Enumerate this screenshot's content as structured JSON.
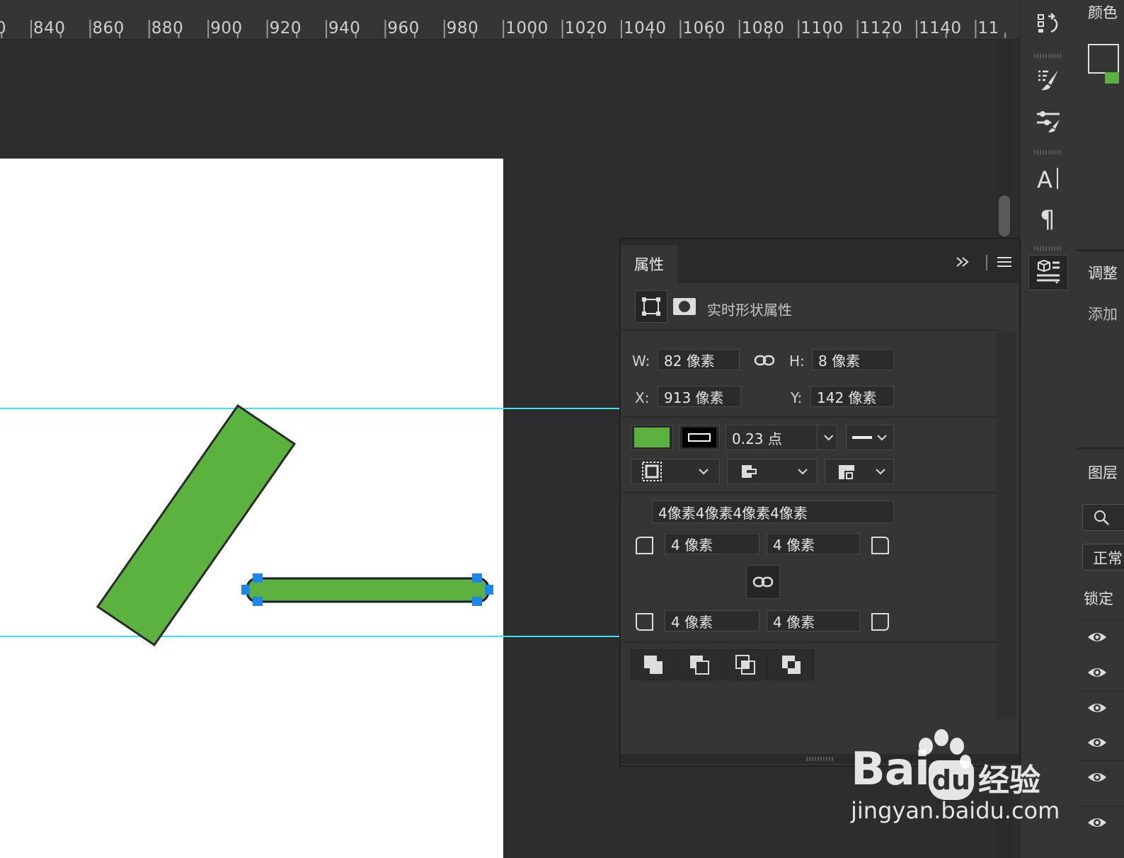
{
  "ruler": {
    "labels": [
      "0",
      "840",
      "860",
      "880",
      "900",
      "920",
      "940",
      "960",
      "980",
      "1000",
      "1020",
      "1040",
      "1060",
      "1080",
      "1100",
      "1120",
      "1140",
      "11"
    ]
  },
  "canvas": {
    "document_color": "#ffffff",
    "shape_fill": "#5cb23f",
    "guide_color": "#39e6f0",
    "handle_color": "#1e86e6"
  },
  "properties": {
    "tab_label": "属性",
    "section_title": "实时形状属性",
    "w_label": "W:",
    "w_value": "82 像素",
    "h_label": "H:",
    "h_value": "8 像素",
    "x_label": "X:",
    "x_value": "913 像素",
    "y_label": "Y:",
    "y_value": "142 像素",
    "fill_color": "#5cb23f",
    "stroke_width": "0.23 点",
    "corner_radii_summary": "4像素4像素4像素4像素",
    "corner_tl": "4 像素",
    "corner_tr": "4 像素",
    "corner_bl": "4 像素",
    "corner_br": "4 像素"
  },
  "right_edge": {
    "color_panel_title": "颜色",
    "adjust_panel_title": "调整",
    "add_label": "添加",
    "layers_title": "图层",
    "blend_mode": "正常",
    "lock_label": "锁定"
  },
  "watermark": {
    "logo": "Bai",
    "cn": "经验",
    "url": "jingyan.baidu.com"
  }
}
